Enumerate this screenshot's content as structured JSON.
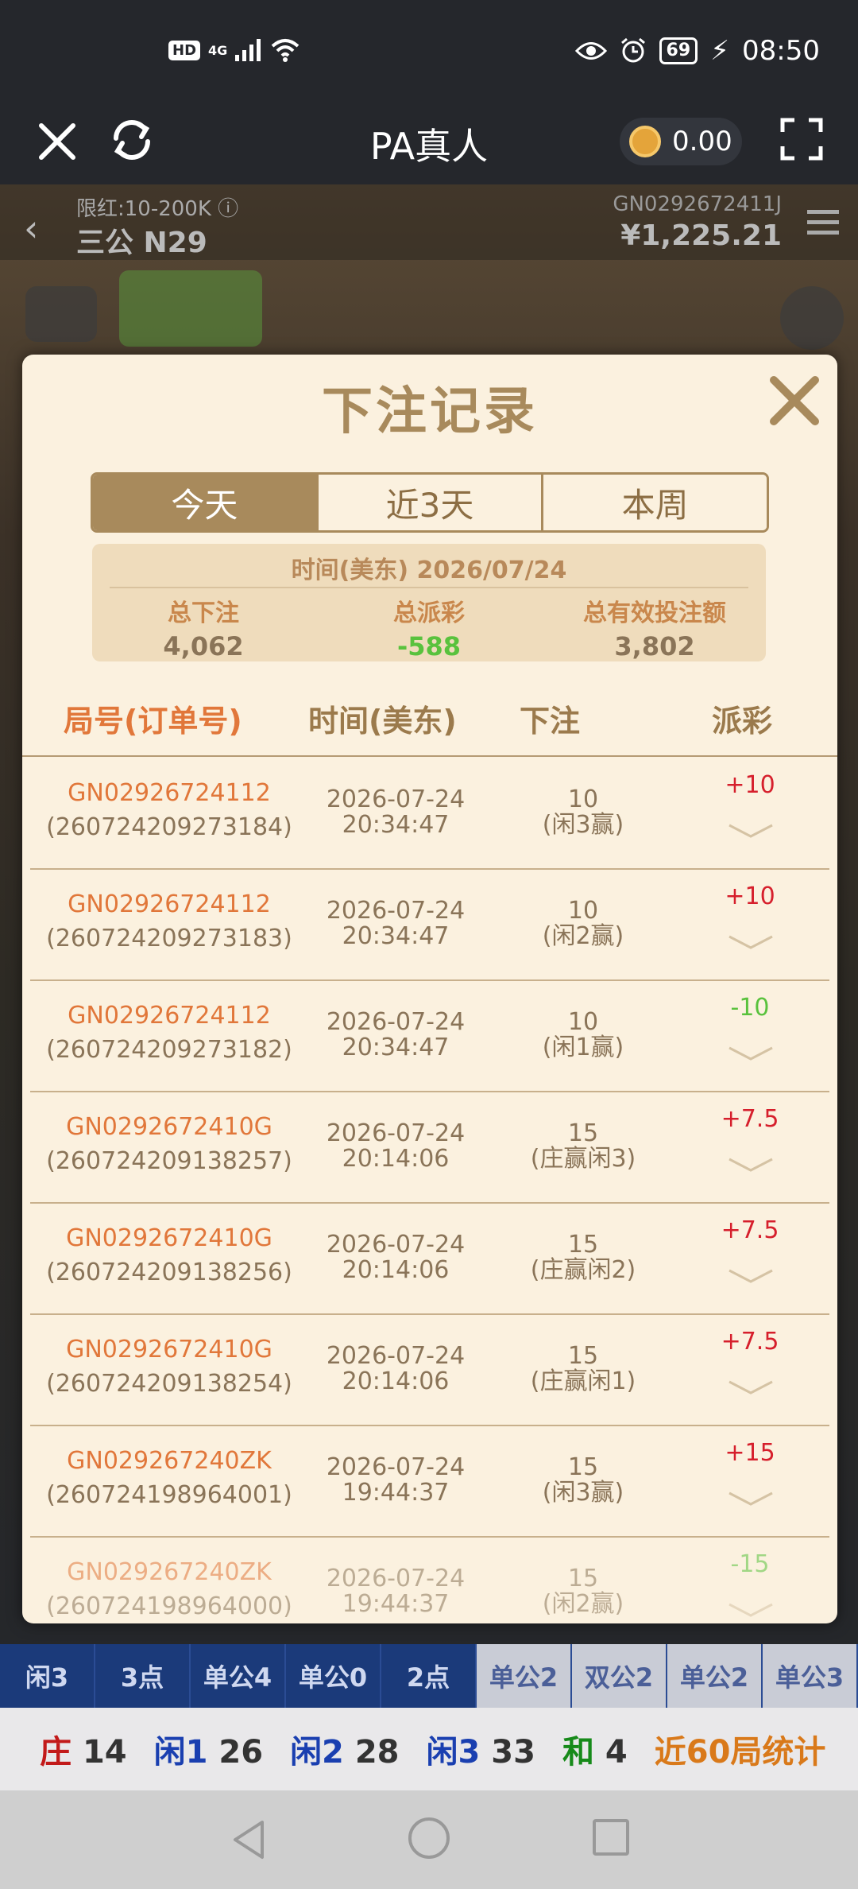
{
  "status_bar": {
    "hd": "HD",
    "net": "4G",
    "battery": "69",
    "time": "08:50"
  },
  "header": {
    "title": "PA真人",
    "balance": "0.00"
  },
  "game": {
    "limit": "限红:10-200K ⓘ",
    "table_name": "三公 N29",
    "round_id": "GN0292672411J",
    "balance": "¥1,225.21"
  },
  "modal": {
    "title": "下注记录",
    "tabs": [
      "今天",
      "近3天",
      "本周"
    ],
    "summary": {
      "date_label": "时间(美东) 2026/07/24",
      "total_bet_label": "总下注",
      "total_bet": "4,062",
      "total_payout_label": "总派彩",
      "total_payout": "-588",
      "total_valid_label": "总有效投注额",
      "total_valid": "3,802"
    },
    "columns": {
      "id": "局号(订单号)",
      "time": "时间(美东)",
      "bet": "下注",
      "payout": "派彩"
    },
    "rows": [
      {
        "gn": "GN02926724112",
        "order": "(260724209273184)",
        "date": "2026-07-24",
        "time": "20:34:47",
        "amount": "10",
        "bet_type": "(闲3赢)",
        "payout": "+10"
      },
      {
        "gn": "GN02926724112",
        "order": "(260724209273183)",
        "date": "2026-07-24",
        "time": "20:34:47",
        "amount": "10",
        "bet_type": "(闲2赢)",
        "payout": "+10"
      },
      {
        "gn": "GN02926724112",
        "order": "(260724209273182)",
        "date": "2026-07-24",
        "time": "20:34:47",
        "amount": "10",
        "bet_type": "(闲1赢)",
        "payout": "-10"
      },
      {
        "gn": "GN0292672410G",
        "order": "(260724209138257)",
        "date": "2026-07-24",
        "time": "20:14:06",
        "amount": "15",
        "bet_type": "(庄赢闲3)",
        "payout": "+7.5"
      },
      {
        "gn": "GN0292672410G",
        "order": "(260724209138256)",
        "date": "2026-07-24",
        "time": "20:14:06",
        "amount": "15",
        "bet_type": "(庄赢闲2)",
        "payout": "+7.5"
      },
      {
        "gn": "GN0292672410G",
        "order": "(260724209138254)",
        "date": "2026-07-24",
        "time": "20:14:06",
        "amount": "15",
        "bet_type": "(庄赢闲1)",
        "payout": "+7.5"
      },
      {
        "gn": "GN029267240ZK",
        "order": "(260724198964001)",
        "date": "2026-07-24",
        "time": "19:44:37",
        "amount": "15",
        "bet_type": "(闲3赢)",
        "payout": "+15"
      },
      {
        "gn": "GN029267240ZK",
        "order": "(260724198964000)",
        "date": "2026-07-24",
        "time": "19:44:37",
        "amount": "15",
        "bet_type": "(闲2赢)",
        "payout": "-15"
      }
    ]
  },
  "road_tabs": [
    "闲3",
    "3点",
    "单公4",
    "单公0",
    "2点",
    "单公2",
    "双公2",
    "单公2",
    "单公3"
  ],
  "stats": {
    "banker_label": "庄",
    "banker": "14",
    "p1_label": "闲1",
    "p1": "26",
    "p2_label": "闲2",
    "p2": "28",
    "p3_label": "闲3",
    "p3": "33",
    "tie_label": "和",
    "tie": "4",
    "recent_label": "近60局统计"
  }
}
